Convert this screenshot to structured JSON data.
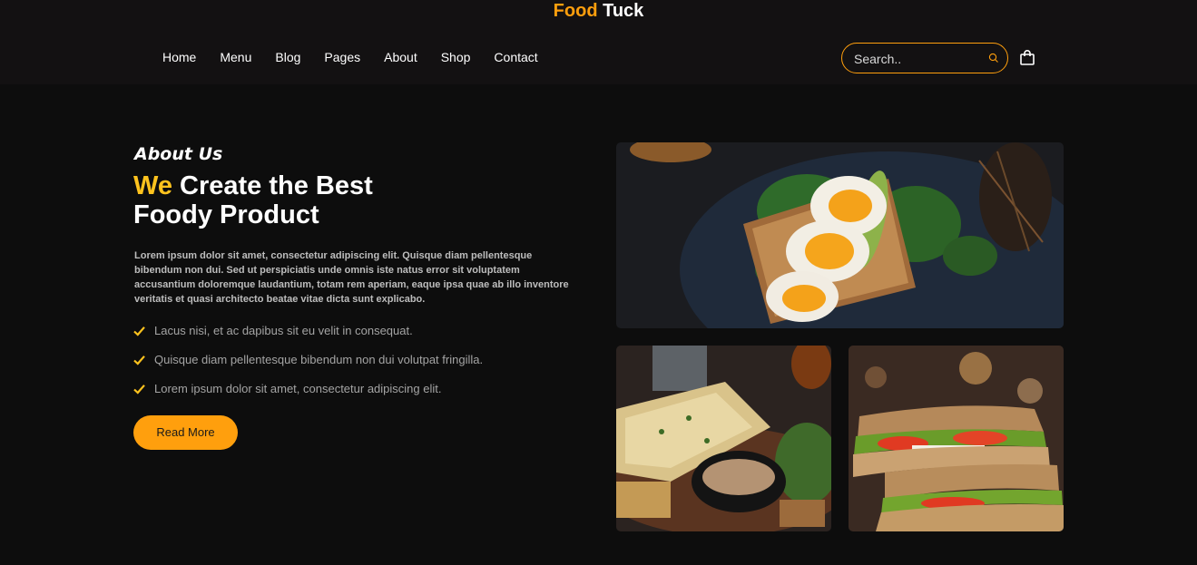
{
  "brand": {
    "part1": "Food",
    "part2": "Tuck"
  },
  "nav": [
    "Home",
    "Menu",
    "Blog",
    "Pages",
    "About",
    "Shop",
    "Contact"
  ],
  "search": {
    "placeholder": "Search.."
  },
  "icons": {
    "search": "search-icon",
    "cart": "shopping-bag-icon",
    "check": "check-icon"
  },
  "about": {
    "eyebrow": "About Us",
    "headline_accent": "We",
    "headline_line1": " Create the Best",
    "headline_line2": "Foody Product",
    "paragraph": "Lorem ipsum dolor sit amet, consectetur adipiscing elit. Quisque diam pellentesque bibendum non dui. Sed ut perspiciatis unde omnis iste natus error sit voluptatem accusantium doloremque laudantium, totam rem aperiam, eaque ipsa quae ab illo inventore veritatis et quasi architecto beatae vitae dicta sunt explicabo.",
    "checklist": [
      "Lacus nisi, et ac dapibus sit eu velit in consequat.",
      "Quisque diam pellentesque bibendum non dui volutpat fringilla.",
      "Lorem ipsum dolor sit amet, consectetur adipiscing elit."
    ],
    "button": "Read More"
  },
  "colors": {
    "accent": "#ff9f0d",
    "headline_accent": "#ffc31e",
    "background": "#0d0d0d",
    "header": "#131112"
  }
}
